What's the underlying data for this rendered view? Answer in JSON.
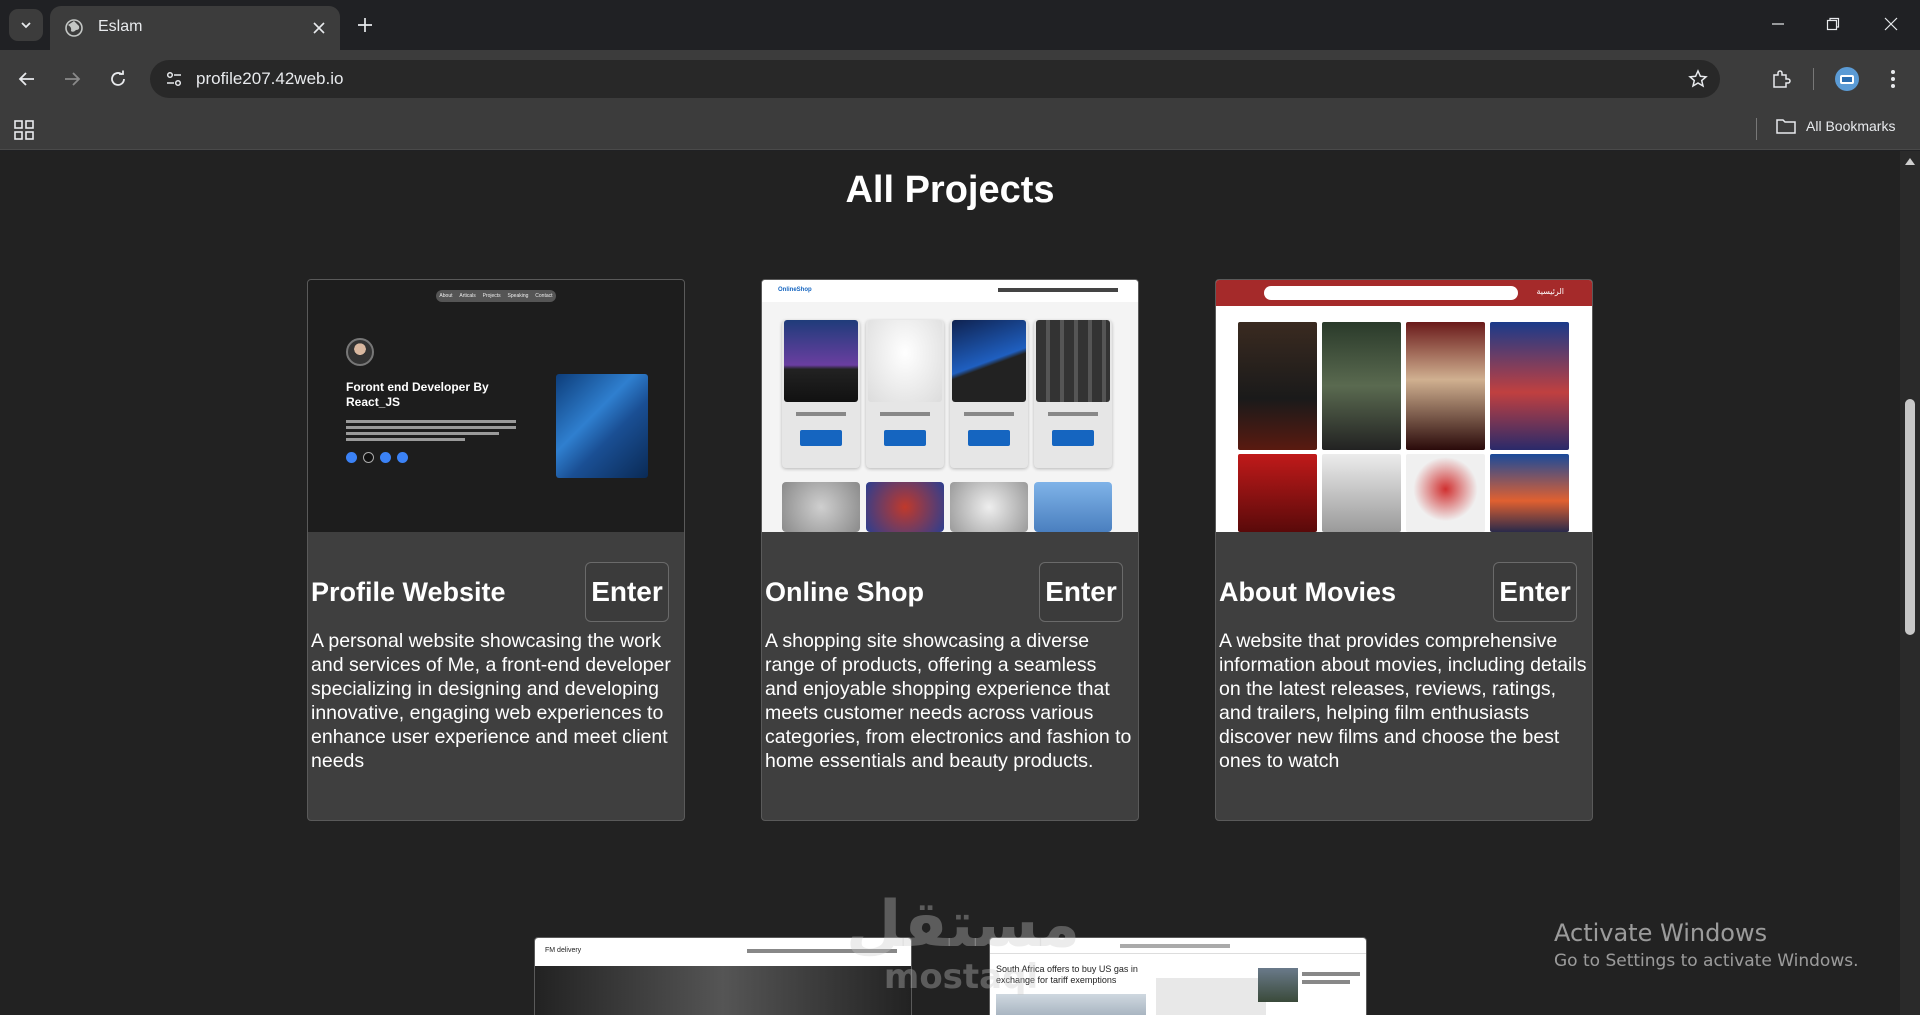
{
  "browser": {
    "tab_title": "Eslam",
    "url": "profile207.42web.io",
    "bookmarks_label": "All Bookmarks"
  },
  "page": {
    "title": "All Projects"
  },
  "projects": [
    {
      "title": "Profile Website",
      "enter_label": "Enter",
      "description": "A personal website showcasing the work and services of Me, a front-end developer specializing in designing and developing innovative, engaging web experiences to enhance user experience and meet client needs",
      "thumb": {
        "nav": [
          "About",
          "Articals",
          "Projects",
          "Speaking",
          "Contact"
        ],
        "headline": "Foront end Developer By React_JS"
      }
    },
    {
      "title": "Online Shop",
      "enter_label": "Enter",
      "description": "A shopping site showcasing a diverse range of products, offering a seamless and enjoyable shopping experience that meets customer needs across various categories, from electronics and fashion to home essentials and beauty products.",
      "thumb": {
        "brand": "OnlineShop"
      }
    },
    {
      "title": "About Movies",
      "enter_label": "Enter",
      "description": "A website that provides comprehensive information about movies, including details on the latest releases, reviews, ratings, and trailers, helping film enthusiasts discover new films and choose the best ones to watch",
      "thumb": {
        "home_label": "الرئيسية"
      }
    }
  ],
  "more_projects": [
    {
      "brand": "FM delivery"
    },
    {
      "headline": "South Africa offers to buy US gas in exchange for tariff exemptions"
    }
  ],
  "watermark": {
    "line1": "مستقل",
    "line2": "mostaql"
  },
  "activation": {
    "title": "Activate Windows",
    "subtitle": "Go to Settings to activate Windows."
  },
  "colors": {
    "page_bg": "#222222",
    "card_bg": "#3f3f3f",
    "shop_blue": "#1565c0",
    "movie_red": "#a52a2a"
  }
}
